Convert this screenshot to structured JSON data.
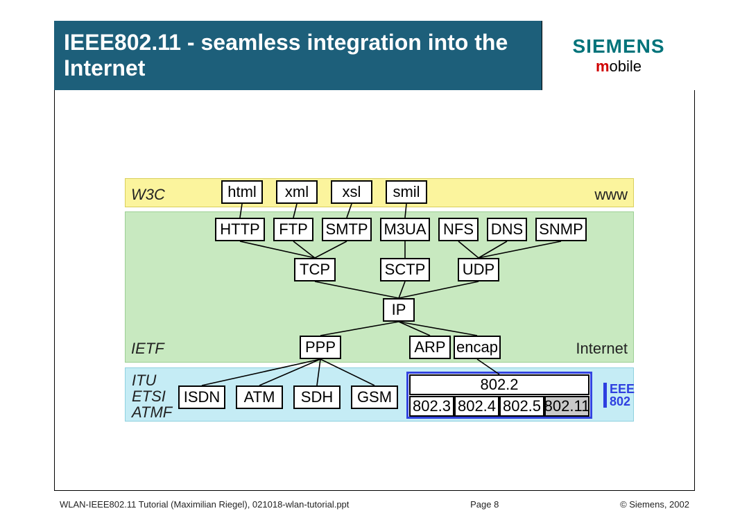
{
  "title": "IEEE802.11 - seamless integration into the Internet",
  "brand": {
    "siemens": "SIEMENS",
    "mobile_m": "m",
    "mobile_rest": "obile"
  },
  "layers": {
    "w3c": {
      "left_label": "W3C",
      "right_label": "www",
      "boxes": [
        "html",
        "xml",
        "xsl",
        "smil"
      ]
    },
    "ietf": {
      "left_label": "IETF",
      "right_label": "Internet",
      "app": [
        "HTTP",
        "FTP",
        "SMTP",
        "M3UA",
        "NFS",
        "DNS",
        "SNMP"
      ],
      "transport": [
        "TCP",
        "SCTP",
        "UDP"
      ],
      "network": [
        "IP"
      ],
      "link": [
        "PPP",
        "ARP",
        "encap"
      ]
    },
    "itu": {
      "left_labels": [
        "ITU",
        "ETSI",
        "ATMF"
      ],
      "boxes": [
        "ISDN",
        "ATM",
        "SDH",
        "GSM"
      ]
    },
    "ieee": {
      "top": "802.2",
      "bottom": [
        "802.3",
        "802.4",
        "802.5",
        "802.11"
      ],
      "highlight_index": 3,
      "logo_top": "EEE",
      "logo_bottom": "802"
    }
  },
  "footer": {
    "left": "WLAN-IEEE802.11 Tutorial (Maximilian Riegel), 021018-wlan-tutorial.ppt",
    "page": "Page  8",
    "right": "© Siemens, 2002"
  }
}
